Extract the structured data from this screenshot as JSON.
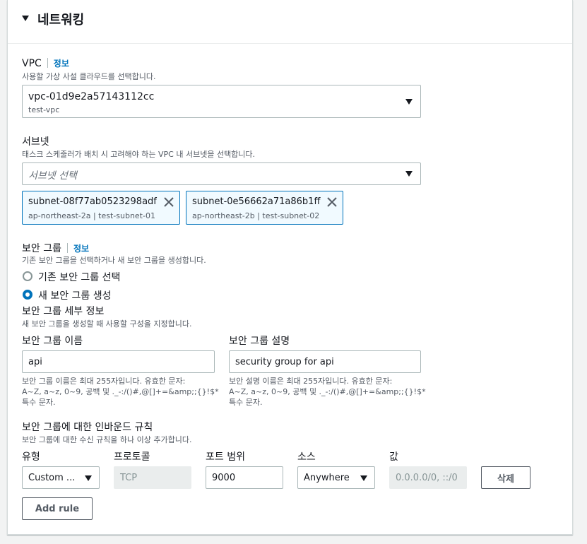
{
  "section": {
    "title": "네트워킹"
  },
  "vpc": {
    "label": "VPC",
    "info": "정보",
    "description": "사용할 가상 사설 클라우드를 선택합니다.",
    "selected_id": "vpc-01d9e2a57143112cc",
    "selected_name": "test-vpc"
  },
  "subnet": {
    "label": "서브넷",
    "description": "태스크 스케줄러가 배치 시 고려해야 하는 VPC 내 서브넷을 선택합니다.",
    "placeholder": "서브넷 선택",
    "tokens": [
      {
        "id": "subnet-08f77ab0523298adf",
        "detail": "ap-northeast-2a | test-subnet-01"
      },
      {
        "id": "subnet-0e56662a71a86b1ff",
        "detail": "ap-northeast-2b | test-subnet-02"
      }
    ]
  },
  "security_group": {
    "label": "보안 그룹",
    "info": "정보",
    "description": "기존 보안 그룹을 선택하거나 새 보안 그룹을 생성합니다.",
    "option_existing": "기존 보안 그룹 선택",
    "option_new": "새 보안 그룹 생성",
    "selected_option": "새 보안 그룹 생성",
    "details_label": "보안 그룹 세부 정보",
    "details_description": "새 보안 그룹을 생성할 때 사용할 구성을 지정합니다.",
    "name_label": "보안 그룹 이름",
    "name_value": "api",
    "name_hint": [
      "보안 그룹 이름은 최대 255자입니다. 유효한 문자:",
      "A~Z, a~z, 0~9, 공백 및 ._-:/()#,@[]+=&amp;;{}!$*",
      "특수 문자."
    ],
    "desc_label": "보안 그룹 설명",
    "desc_value": "security group for api",
    "desc_hint": [
      "보안 설명 이름은 최대 255자입니다. 유효한 문자:",
      "A~Z, a~z, 0~9, 공백 및 ._-:/()#,@[]+=&amp;;{}!$*",
      "특수 문자."
    ]
  },
  "inbound": {
    "label": "보안 그룹에 대한 인바운드 규칙",
    "description": "보안 그룹에 대한 수신 규칙을 하나 이상 추가합니다.",
    "columns": [
      "유형",
      "프로토콜",
      "포트 범위",
      "소스",
      "값"
    ],
    "rule": {
      "type": "Custom ...",
      "protocol": "TCP",
      "port_range": "9000",
      "source": "Anywhere",
      "value": "0.0.0.0/0, ::/0",
      "delete_label": "삭제"
    },
    "add_rule_label": "Add rule"
  },
  "colors": {
    "link": "#0073bb",
    "token_bg": "#f1faff",
    "token_border": "#0073bb",
    "text": "#16191f",
    "muted": "#545b64"
  }
}
